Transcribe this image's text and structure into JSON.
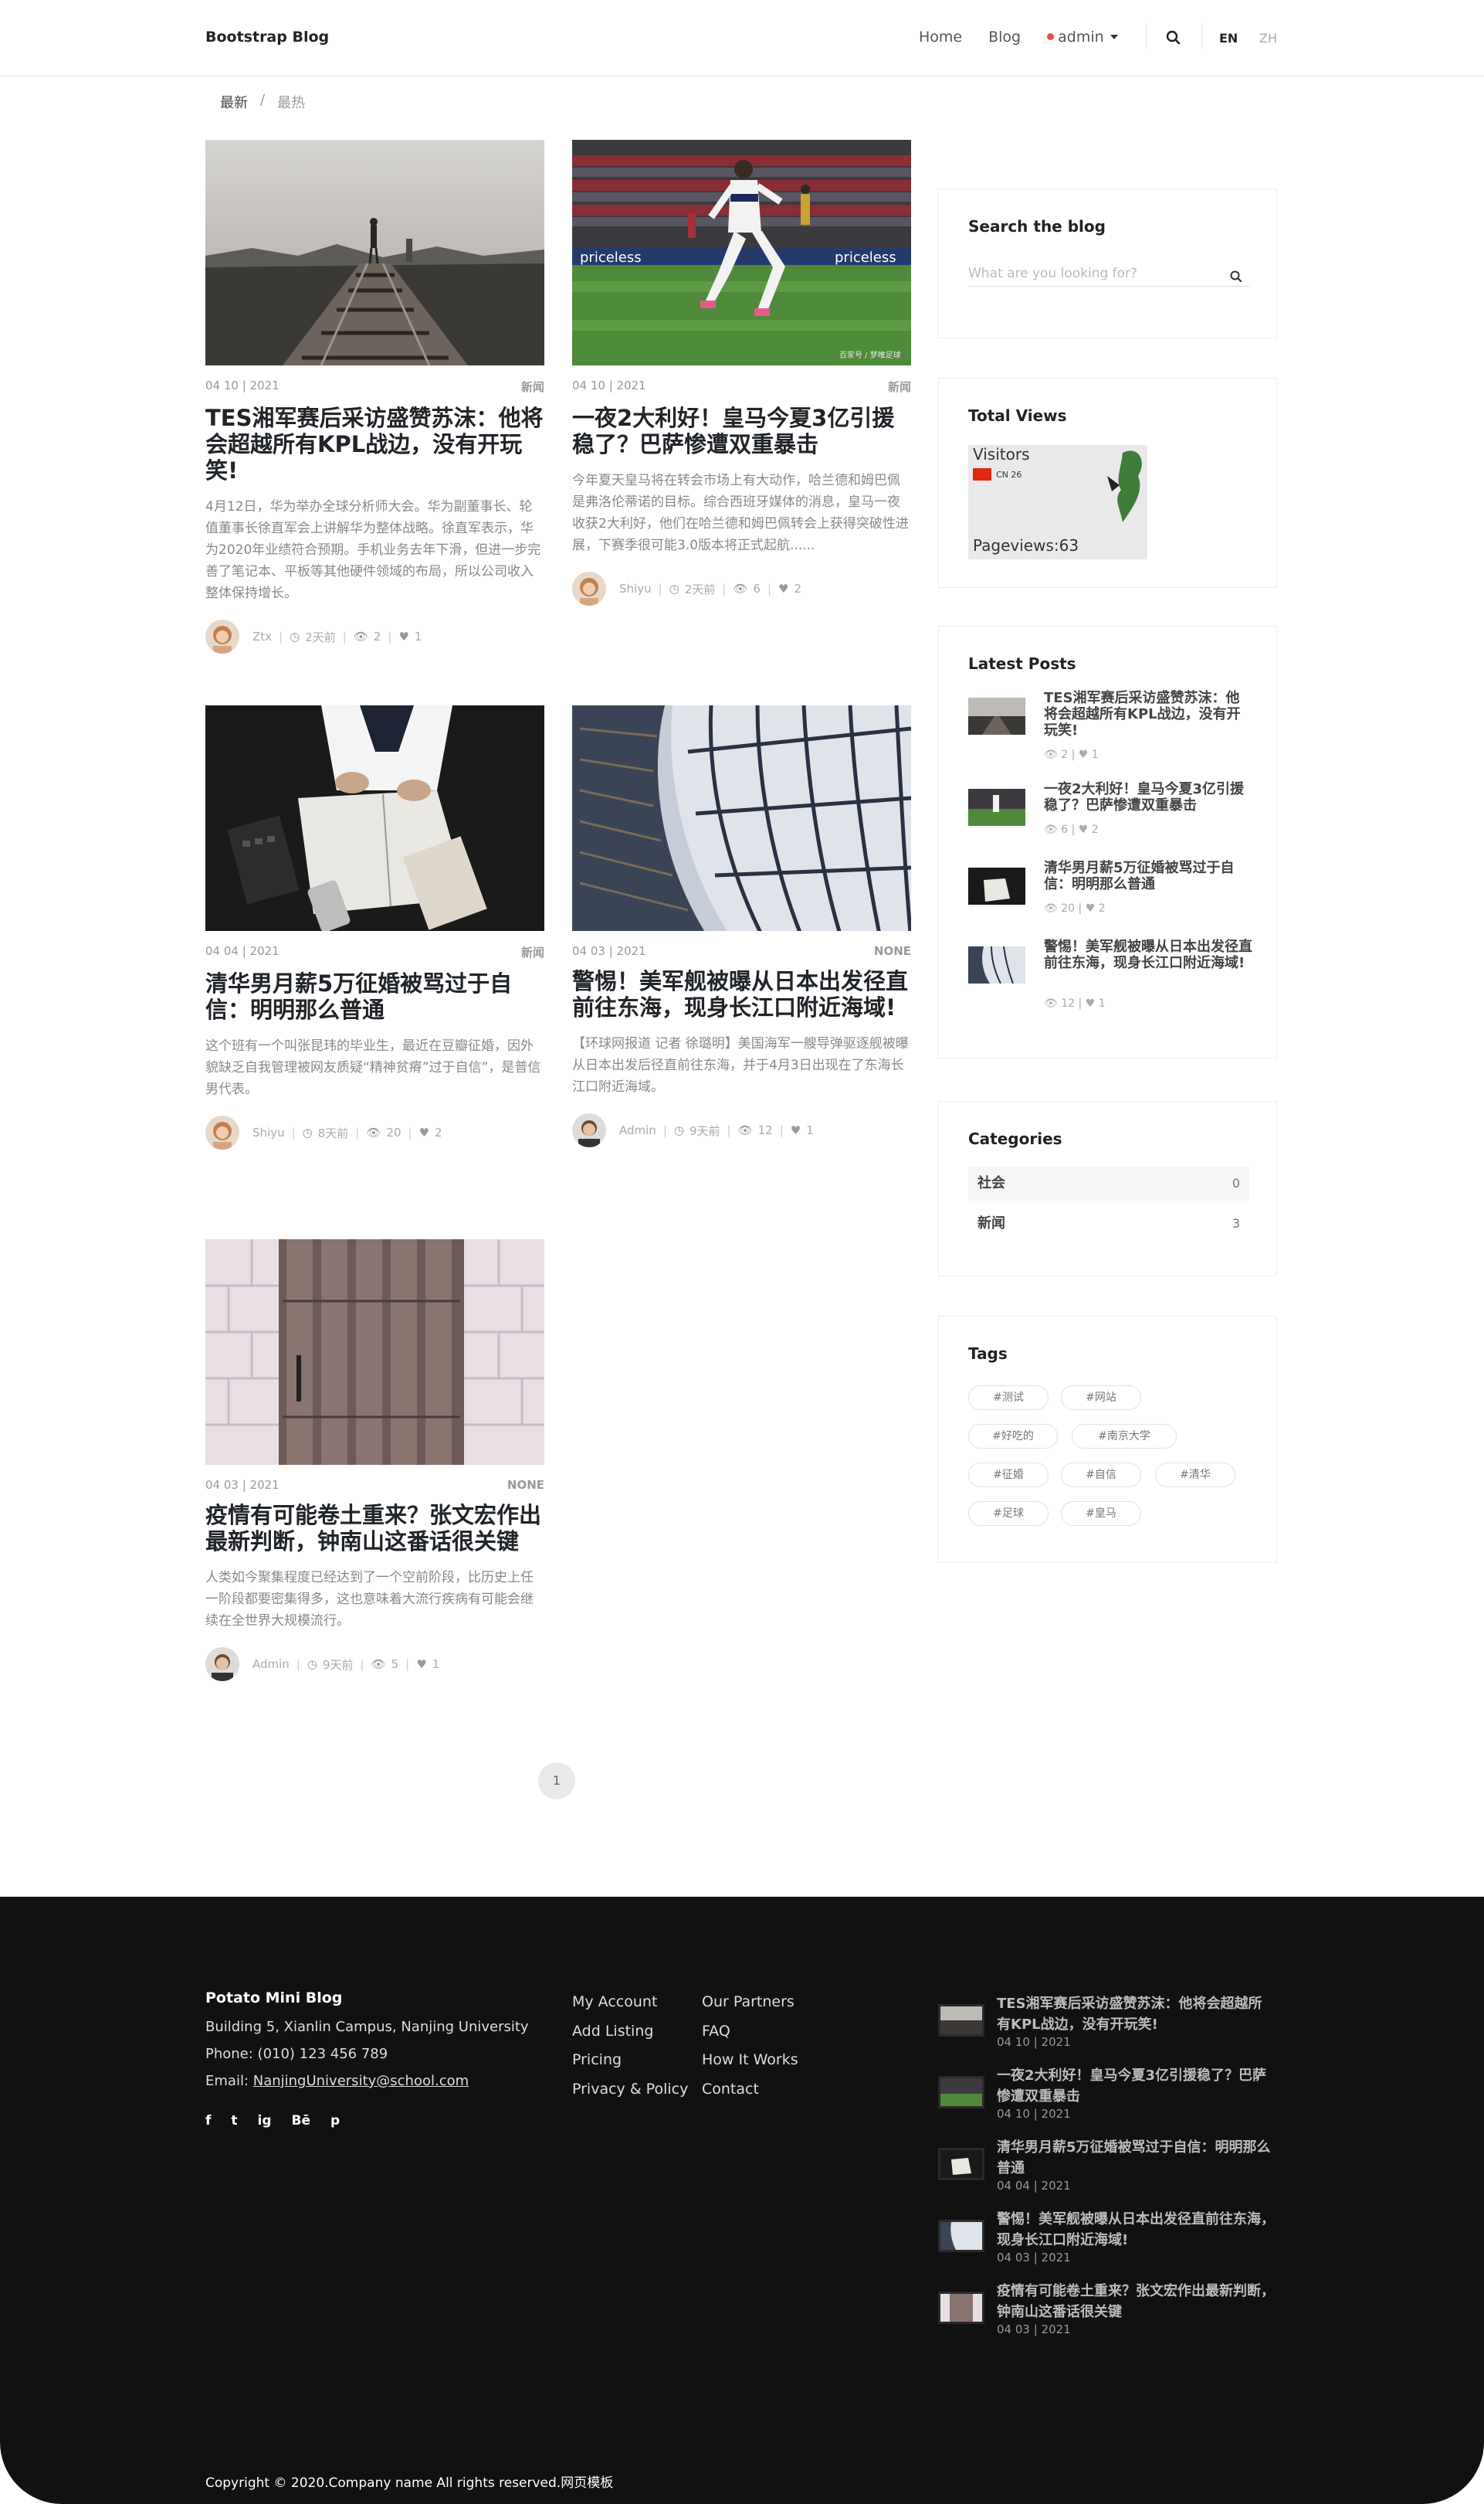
{
  "header": {
    "brand": "Bootstrap Blog",
    "nav": [
      "Home",
      "Blog"
    ],
    "user": "admin",
    "lang_en": "EN",
    "lang_zh": "ZH"
  },
  "breadcrumb": {
    "latest": "最新",
    "separator": "/",
    "hottest": "最热"
  },
  "posts": [
    {
      "date": "04 10 | 2021",
      "category": "新闻",
      "title": "TES湘军赛后采访盛赞苏沫：他将会超越所有KPL战边，没有开玩笑!",
      "excerpt": "4月12日，华为举办全球分析师大会。华为副董事长、轮值董事长徐直军会上讲解华为整体战略。徐直军表示，华为2020年业绩符合预期。手机业务去年下滑，但进一步完善了笔记本、平板等其他硬件领域的布局，所以公司收入整体保持增长。",
      "author": "Ztx",
      "time": "2天前",
      "views": "2",
      "likes": "1"
    },
    {
      "date": "04 10 | 2021",
      "category": "新闻",
      "title": "一夜2大利好！皇马今夏3亿引援稳了？巴萨惨遭双重暴击",
      "excerpt": "今年夏天皇马将在转会市场上有大动作，哈兰德和姆巴佩是弗洛伦蒂诺的目标。综合西班牙媒体的消息，皇马一夜收获2大利好，他们在哈兰德和姆巴佩转会上获得突破性进展，下赛季很可能3.0版本将正式起航......",
      "author": "Shiyu",
      "time": "2天前",
      "views": "6",
      "likes": "2",
      "photo_caption": "百家号 / 梦唯足球"
    },
    {
      "date": "04 04 | 2021",
      "category": "新闻",
      "title": "清华男月薪5万征婚被骂过于自信：明明那么普通",
      "excerpt": "这个班有一个叫张昆玮的毕业生，最近在豆瓣征婚，因外貌缺乏自我管理被网友质疑“精神贫瘠”过于自信”，是普信男代表。",
      "author": "Shiyu",
      "time": "8天前",
      "views": "20",
      "likes": "2"
    },
    {
      "date": "04 03 | 2021",
      "category": "NONE",
      "title": "警惕！美军舰被曝从日本出发径直前往东海，现身长江口附近海域!",
      "excerpt": "【环球网报道 记者 徐璐明】美国海军一艘导弹驱逐舰被曝从日本出发后径直前往东海，并于4月3日出现在了东海长江口附近海域。",
      "author": "Admin",
      "time": "9天前",
      "views": "12",
      "likes": "1"
    },
    {
      "date": "04 03 | 2021",
      "category": "NONE",
      "title": "疫情有可能卷土重来？张文宏作出最新判断，钟南山这番话很关键",
      "excerpt": "人类如今聚集程度已经达到了一个空前阶段，比历史上任一阶段都要密集得多，这也意味着大流行疾病有可能会继续在全世界大规模流行。",
      "author": "Admin",
      "time": "9天前",
      "views": "5",
      "likes": "1"
    }
  ],
  "pagination": {
    "current": "1"
  },
  "sidebar": {
    "search": {
      "title": "Search the blog",
      "placeholder": "What are you looking for?"
    },
    "views": {
      "title": "Total Views",
      "visitors": "Visitors",
      "country": "CN 26",
      "pageviews": "Pageviews:63"
    },
    "latest": {
      "title": "Latest Posts",
      "items": [
        {
          "title": "TES湘军赛后采访盛赞苏沫：他将会超越所有KPL战边，没有开玩笑!",
          "views": "2",
          "likes": "1"
        },
        {
          "title": "一夜2大利好！皇马今夏3亿引援稳了？巴萨惨遭双重暴击",
          "views": "6",
          "likes": "2"
        },
        {
          "title": "清华男月薪5万征婚被骂过于自信：明明那么普通",
          "views": "20",
          "likes": "2"
        },
        {
          "title": "警惕！美军舰被曝从日本出发径直前往东海，现身长江口附近海域!",
          "views": "12",
          "likes": "1"
        }
      ]
    },
    "categories": {
      "title": "Categories",
      "items": [
        {
          "name": "社会",
          "count": "0"
        },
        {
          "name": "新闻",
          "count": "3"
        }
      ]
    },
    "tags": {
      "title": "Tags",
      "items": [
        "#测试",
        "#网站",
        "#好吃的",
        "#南京大学",
        "#征婚",
        "#自信",
        "#清华",
        "#足球",
        "#皇马"
      ]
    }
  },
  "footer": {
    "title": "Potato Mini Blog",
    "address": "Building 5, Xianlin Campus, Nanjing University",
    "phone": "Phone: (010) 123 456 789",
    "email_label": "Email: ",
    "email": "NanjingUniversity@school.com",
    "social": [
      "f",
      "t",
      "ig",
      "Bē",
      "p"
    ],
    "links_col1": [
      "My Account",
      "Add Listing",
      "Pricing",
      "Privacy & Policy"
    ],
    "links_col2": [
      "Our Partners",
      "FAQ",
      "How It Works",
      "Contact"
    ],
    "recent": [
      {
        "title": "TES湘军赛后采访盛赞苏沫：他将会超越所有KPL战边，没有开玩笑!",
        "date": "04 10 | 2021"
      },
      {
        "title": "一夜2大利好！皇马今夏3亿引援稳了？巴萨惨遭双重暴击",
        "date": "04 10 | 2021"
      },
      {
        "title": "清华男月薪5万征婚被骂过于自信：明明那么普通",
        "date": "04 04 | 2021"
      },
      {
        "title": "警惕！美军舰被曝从日本出发径直前往东海，现身长江口附近海域!",
        "date": "04 03 | 2021"
      },
      {
        "title": "疫情有可能卷土重来？张文宏作出最新判断，钟南山这番话很关键",
        "date": "04 03 | 2021"
      }
    ],
    "copyright": "Copyright © 2020.Company name All rights reserved.网页模板"
  }
}
